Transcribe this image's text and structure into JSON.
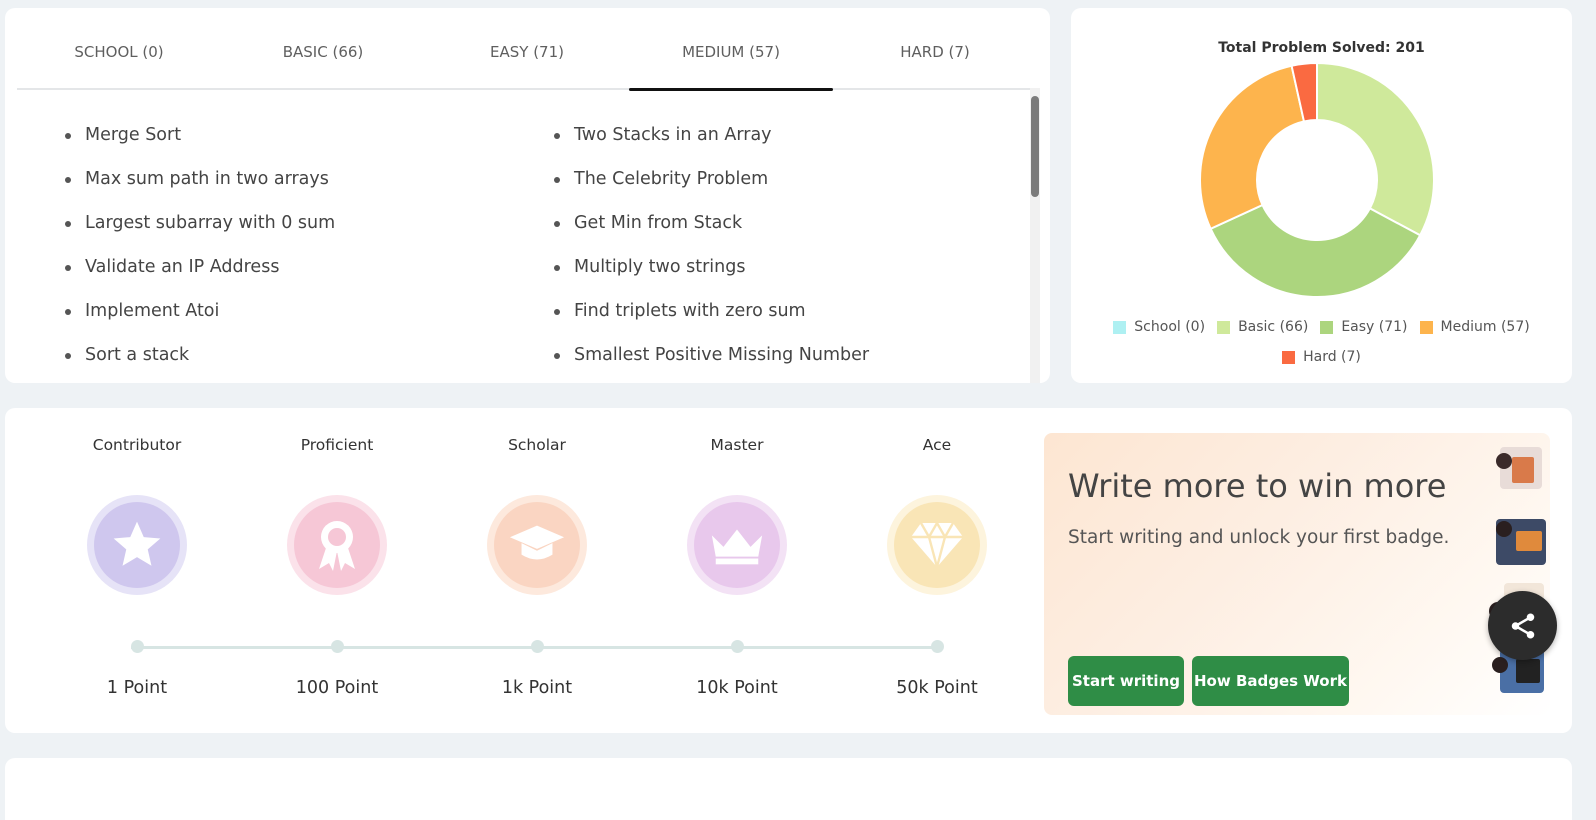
{
  "tabs": [
    {
      "label": "SCHOOL (0)"
    },
    {
      "label": "BASIC (66)"
    },
    {
      "label": "EASY (71)"
    },
    {
      "label": "MEDIUM (57)"
    },
    {
      "label": "HARD (7)"
    }
  ],
  "active_tab": "MEDIUM (57)",
  "problems": {
    "left": [
      "Merge Sort",
      "Max sum path in two arrays",
      "Largest subarray with 0 sum",
      "Validate an IP Address",
      "Implement Atoi",
      "Sort a stack"
    ],
    "right": [
      "Two Stacks in an Array",
      "The Celebrity Problem",
      "Get Min from Stack",
      "Multiply two strings",
      "Find triplets with zero sum",
      "Smallest Positive Missing Number"
    ]
  },
  "chart_data": {
    "type": "pie",
    "title": "Total Problem Solved: 201",
    "categories": [
      "School (0)",
      "Basic (66)",
      "Easy (71)",
      "Medium (57)",
      "Hard (7)"
    ],
    "values": [
      0,
      66,
      71,
      57,
      7
    ],
    "colors": [
      "#aef0f2",
      "#cfe99b",
      "#acd57e",
      "#fdb44d",
      "#fa6a41"
    ],
    "donut": true,
    "legend_position": "bottom"
  },
  "badges": [
    {
      "name": "Contributor",
      "points": "1 Point",
      "icon": "star-icon",
      "outer": "#e6e3f7",
      "inner": "#cfc7ee"
    },
    {
      "name": "Proficient",
      "points": "100 Point",
      "icon": "award-ribbon-icon",
      "outer": "#fbe2ea",
      "inner": "#f6c7d6"
    },
    {
      "name": "Scholar",
      "points": "1k Point",
      "icon": "graduation-cap-icon",
      "outer": "#fde9dd",
      "inner": "#fad5c2"
    },
    {
      "name": "Master",
      "points": "10k Point",
      "icon": "crown-icon",
      "outer": "#f3e2f5",
      "inner": "#e8c8ec"
    },
    {
      "name": "Ace",
      "points": "50k Point",
      "icon": "diamond-icon",
      "outer": "#fdf4dd",
      "inner": "#f9e5b6"
    }
  ],
  "promo": {
    "title": "Write more to win more",
    "subtitle": "Start writing and unlock your first badge.",
    "start_button": "Start writing",
    "how_button": "How Badges Work"
  },
  "share": {
    "icon": "share-icon"
  }
}
